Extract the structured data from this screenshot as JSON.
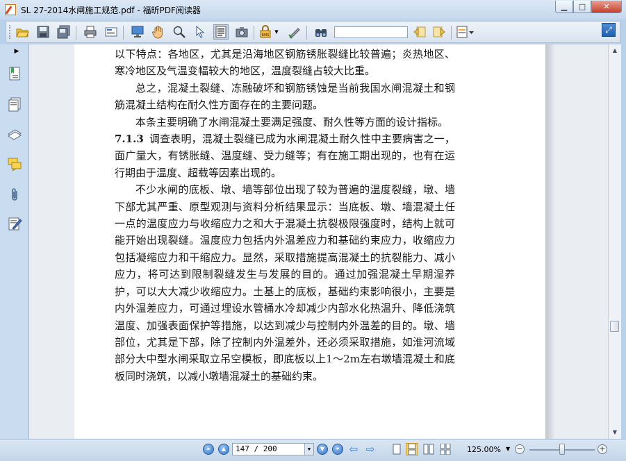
{
  "window": {
    "title": "SL 27-2014水闸施工规范.pdf - 福昕PDF阅读器",
    "minimize_label": "▁",
    "maximize_label": "□",
    "close_label": "✕"
  },
  "toolbar": {
    "search_value": "",
    "buttons": [
      "open-icon",
      "save-icon",
      "save-as-icon",
      "print-icon",
      "email-icon",
      "fullscreen-icon",
      "hand-tool-icon",
      "zoom-tool-icon",
      "select-arrow-icon",
      "text-select-icon",
      "snapshot-icon",
      "rms-icon",
      "sign-icon",
      "find-icon",
      "prev-result-icon",
      "next-result-icon",
      "highlight-icon"
    ],
    "rms_label": "RMS"
  },
  "left_panel": {
    "toggle_label": "▶",
    "icons": [
      "bookmarks-icon",
      "pages-icon",
      "layers-icon",
      "comments-icon",
      "attachments-icon",
      "signatures-icon"
    ]
  },
  "document": {
    "lines": [
      {
        "text": "以下特点：各地区，尤其是沿海地区钢筋锈胀裂缝比较普遍；炎热地区、寒冷地区及气温变幅较大的地区，温度裂缝占较大比重。",
        "indent": false
      },
      {
        "text": "总之，混凝土裂缝、冻融破坏和钢筋锈蚀是当前我国水闸混凝土和钢筋混凝土结构在耐久性方面存在的主要问题。",
        "indent": true
      },
      {
        "text": "本条主要明确了水闸混凝土要满足强度、耐久性等方面的设计指标。",
        "indent": true
      }
    ],
    "section_number": "7.1.3",
    "section_text": "调查表明，混凝土裂缝已成为水闸混凝土耐久性中主要病害之一，面广量大，有锈胀缝、温度缝、受力缝等；有在施工期出现的，也有在运行期由于温度、超载等因素出现的。",
    "para_last": "不少水闸的底板、墩、墙等部位出现了较为普遍的温度裂缝，墩、墙下部尤其严重、原型观测与资料分析结果显示：当底板、墩、墙混凝土任一点的温度应力与收缩应力之和大于混凝土抗裂极限强度时，结构上就可能开始出现裂缝。温度应力包括内外温差应力和基础约束应力，收缩应力包括凝缩应力和干缩应力。显然，采取措施提高混凝土的抗裂能力、减小应力，将可达到限制裂缝发生与发展的目的。通过加强混凝土早期湿养护，可以大大减少收缩应力。土基上的底板，基础约束影响很小，主要是内外温差应力，可通过埋设水管桶水冷却减少内部水化热温升、降低浇筑温度、加强表面保护等措施，以达到减少与控制内外温差的目的。墩、墙部位，尤其是下部，除了控制内外温差外，还必须采取措施，如淮河流域部分大中型水闸采取立吊空模板，即底板以上1～2m左右墩墙混凝土和底板同时浇筑，以减小墩墙混凝土的基础约束。"
  },
  "statusbar": {
    "page_display": "147 / 200",
    "current_page": 147,
    "total_pages": 200,
    "zoom": "125.00%",
    "zoom_level_fraction": 0.46,
    "dropdown_arrow": "▼"
  },
  "colors": {
    "accent": "#2f74c8",
    "window_frame": "#b9d1ea",
    "page_bg": "#ffffff"
  }
}
